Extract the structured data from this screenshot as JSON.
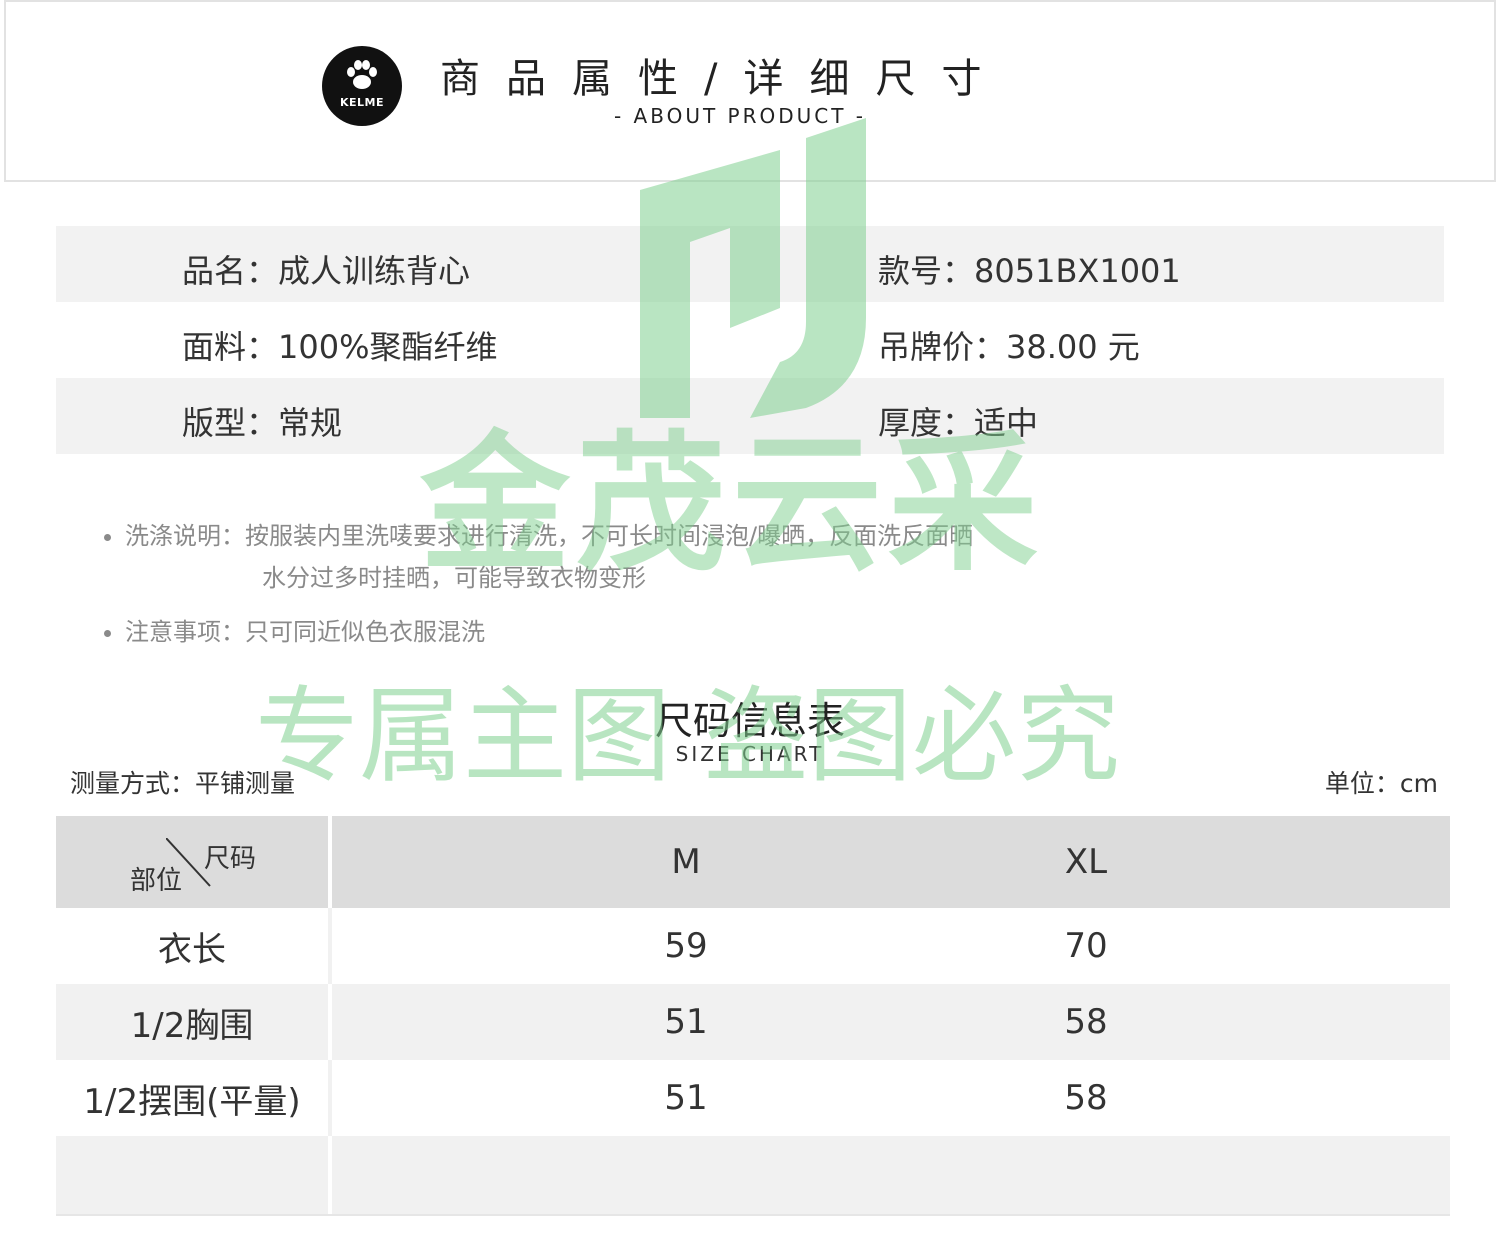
{
  "header": {
    "brand": "KELME",
    "title": "商品属性/详细尺寸",
    "subtitle": "- ABOUT PRODUCT -"
  },
  "attributes": [
    {
      "label": "品名：",
      "value": "成人训练背心",
      "label2": "款号：",
      "value2": "8051BX1001"
    },
    {
      "label": "面料：",
      "value": "100%聚酯纤维",
      "label2": "吊牌价：",
      "value2": "38.00 元"
    },
    {
      "label": "版型：",
      "value": "常规",
      "label2": "厚度：",
      "value2": "适中"
    }
  ],
  "notes": {
    "wash_label": "洗涤说明：",
    "wash_line1": "按服装内里洗唛要求进行清洗，不可长时间浸泡/曝晒，反面洗反面晒",
    "wash_line2": "水分过多时挂晒，可能导致衣物变形",
    "caution_label": "注意事项：",
    "caution_text": "只可同近似色衣服混洗"
  },
  "size_chart": {
    "title": "尺码信息表",
    "subtitle": "SIZE CHART",
    "measure_method": "测量方式：平铺测量",
    "unit": "单位：cm",
    "header_size": "尺码",
    "header_part": "部位",
    "sizes": [
      "M",
      "XL"
    ],
    "rows": [
      {
        "part": "衣长",
        "values": [
          "59",
          "70"
        ]
      },
      {
        "part": "1/2胸围",
        "values": [
          "51",
          "58"
        ]
      },
      {
        "part": "1/2摆围(平量)",
        "values": [
          "51",
          "58"
        ]
      }
    ]
  },
  "watermark": {
    "line1": "金茂云采",
    "line2": "专属主图 盗图必究",
    "color": "#7fd08f"
  }
}
